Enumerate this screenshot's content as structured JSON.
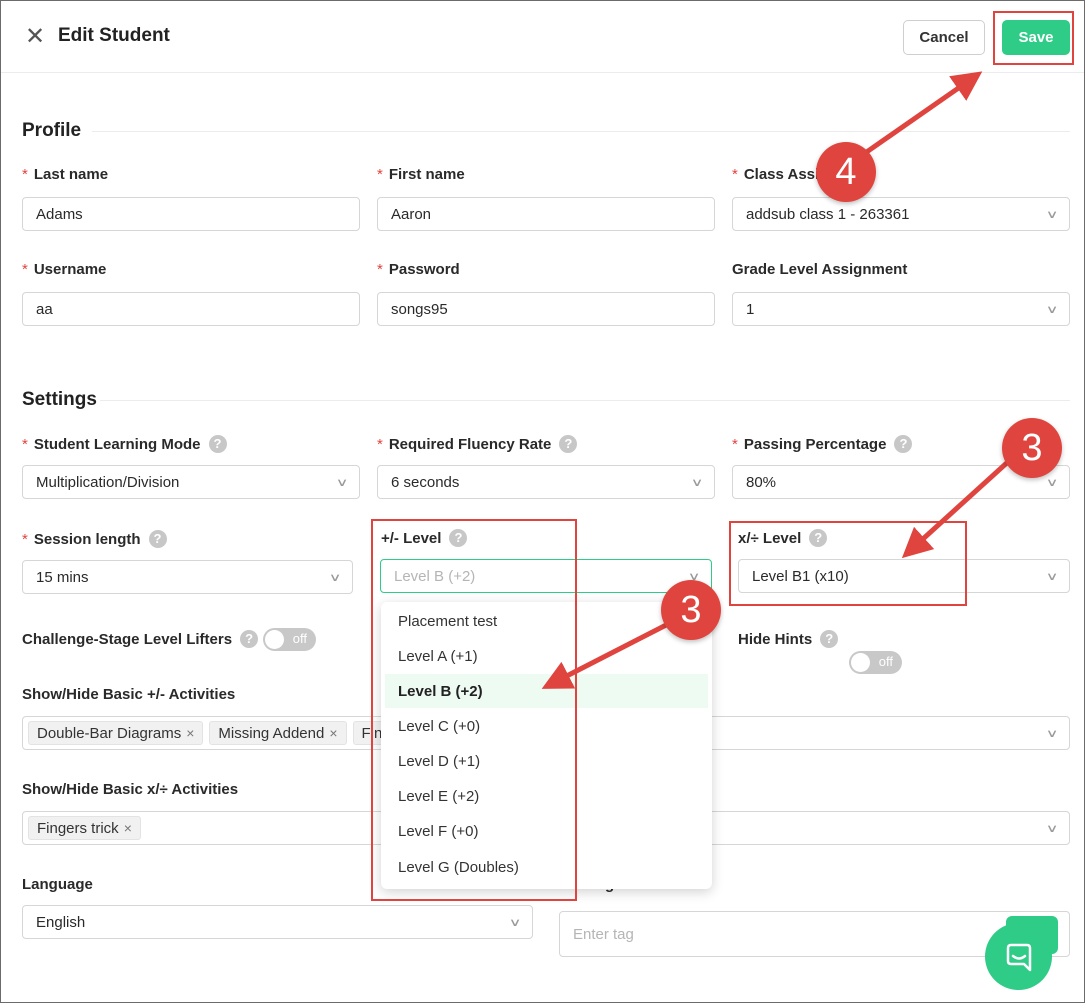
{
  "header": {
    "title": "Edit Student",
    "cancel_label": "Cancel",
    "save_label": "Save"
  },
  "profile": {
    "section_title": "Profile",
    "last_name": {
      "label": "Last name",
      "value": "Adams"
    },
    "first_name": {
      "label": "First name",
      "value": "Aaron"
    },
    "class_assignment": {
      "label": "Class Assig",
      "value": "addsub class 1 - 263361"
    },
    "username": {
      "label": "Username",
      "value": "aa"
    },
    "password": {
      "label": "Password",
      "value": "songs95"
    },
    "grade_level": {
      "label": "Grade Level Assignment",
      "value": "1"
    }
  },
  "settings": {
    "section_title": "Settings",
    "learning_mode": {
      "label": "Student Learning Mode",
      "value": "Multiplication/Division"
    },
    "fluency_rate": {
      "label": "Required Fluency Rate",
      "value": "6 seconds"
    },
    "passing_percentage": {
      "label": "Passing Percentage",
      "value": "80%"
    },
    "session_length": {
      "label": "Session length",
      "value": "15 mins"
    },
    "addsub_level": {
      "label": "+/- Level",
      "placeholder": "Level B (+2)"
    },
    "multdiv_level": {
      "label": "x/÷ Level",
      "value": "Level B1 (x10)"
    },
    "level_lifters": {
      "label": "Challenge-Stage Level Lifters",
      "toggle": "off"
    },
    "hide_hints": {
      "label": "Hide Hints",
      "toggle": "off"
    },
    "addsub_activities": {
      "label": "Show/Hide Basic +/- Activities",
      "tags": [
        "Double-Bar Diagrams",
        "Missing Addend",
        "Fin"
      ]
    },
    "multdiv_activities": {
      "label": "Show/Hide Basic x/÷ Activities",
      "tags": [
        "Fingers trick"
      ]
    },
    "language": {
      "label": "Language",
      "value": "English"
    },
    "tag_input": {
      "label": "g",
      "placeholder": "Enter tag"
    }
  },
  "dropdown": {
    "options": [
      "Placement test",
      "Level A (+1)",
      "Level B (+2)",
      "Level C (+0)",
      "Level D (+1)",
      "Level E (+2)",
      "Level F (+0)",
      "Level G (Doubles)"
    ],
    "selected": "Level B (+2)"
  },
  "annotations": {
    "step_save": "4",
    "step_level_a": "3",
    "step_level_b": "3",
    "color": "#e0443e"
  },
  "colors": {
    "accent": "#2ecc86",
    "annotation": "#e0443e"
  },
  "icons": {
    "close": "close-icon",
    "help": "help-icon",
    "chevron": "chevron-down-icon",
    "chat": "chat-icon"
  }
}
